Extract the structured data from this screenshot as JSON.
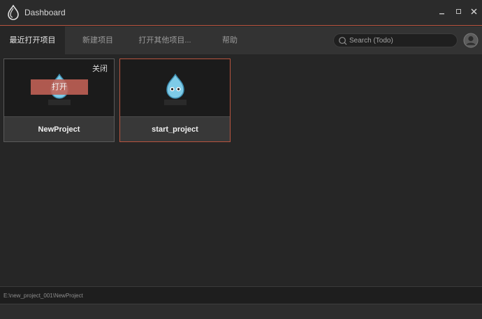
{
  "window": {
    "title": "Dashboard",
    "accent_color": "#b8543f",
    "icons": {
      "logo": "cocos-drop-icon",
      "minimize": "minimize-icon",
      "maximize": "maximize-icon",
      "close": "close-icon"
    }
  },
  "tabs": [
    {
      "label": "最近打开项目",
      "active": true
    },
    {
      "label": "新建项目",
      "active": false
    },
    {
      "label": "打开其他项目...",
      "active": false
    },
    {
      "label": "帮助",
      "active": false
    }
  ],
  "search": {
    "placeholder": "Search (Todo)",
    "value": ""
  },
  "projects": [
    {
      "name": "NewProject",
      "logo_text": "COCOS2D",
      "close_label": "关闭",
      "open_label": "打开",
      "hovered": true
    },
    {
      "name": "start_project",
      "logo_text": "COCOS2D",
      "selected": true
    }
  ],
  "status": {
    "path": "E:\\new_project_001\\NewProject"
  }
}
